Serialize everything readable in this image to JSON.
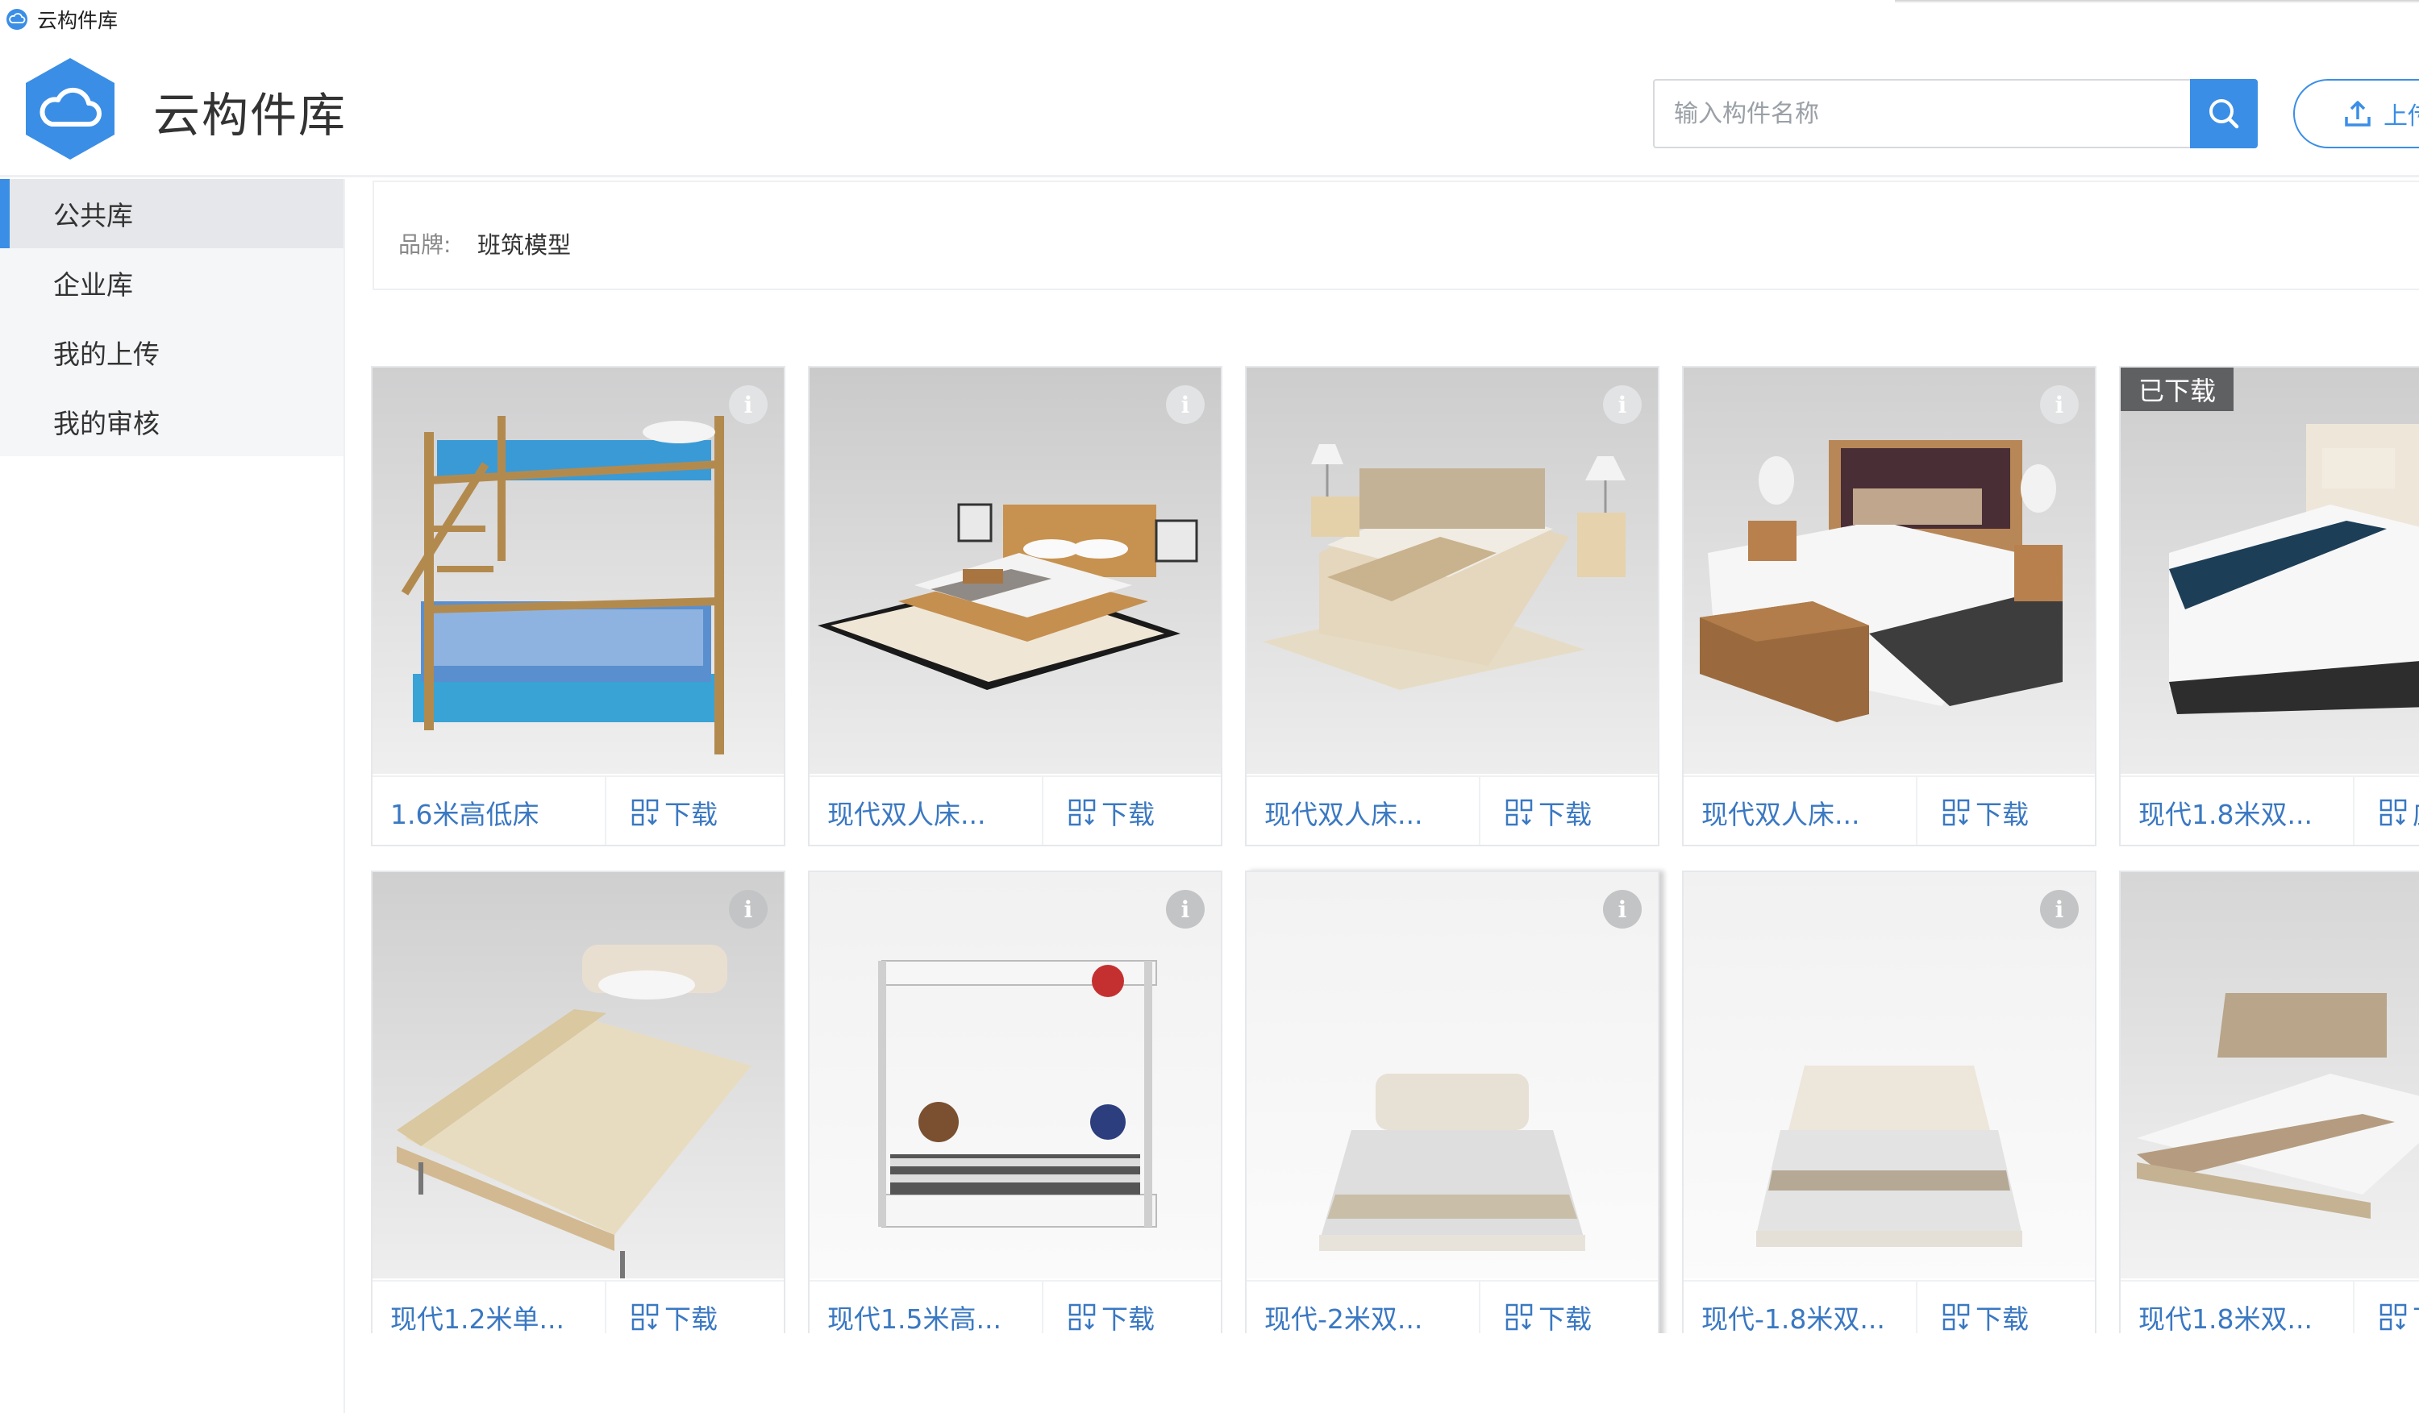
{
  "window": {
    "title": "云构件库"
  },
  "header": {
    "app_title": "云构件库",
    "search_placeholder": "输入构件名称",
    "upload_label": "上传"
  },
  "sidebar": {
    "items": [
      {
        "label": "公共库",
        "active": true
      },
      {
        "label": "企业库",
        "active": false
      },
      {
        "label": "我的上传",
        "active": false
      },
      {
        "label": "我的审核",
        "active": false
      }
    ]
  },
  "filter": {
    "brand_label": "品牌:",
    "brand_value": "班筑模型"
  },
  "cards": [
    {
      "name": "1.6米高低床",
      "download": "下载",
      "info": "i",
      "badge": ""
    },
    {
      "name": "现代双人床...",
      "download": "下载",
      "info": "i",
      "badge": ""
    },
    {
      "name": "现代双人床...",
      "download": "下载",
      "info": "i",
      "badge": ""
    },
    {
      "name": "现代双人床...",
      "download": "下载",
      "info": "i",
      "badge": ""
    },
    {
      "name": "现代1.8米双...",
      "download": "应",
      "info": "",
      "badge": "已下载"
    },
    {
      "name": "现代1.2米单...",
      "download": "下载",
      "info": "i",
      "badge": ""
    },
    {
      "name": "现代1.5米高...",
      "download": "下载",
      "info": "i",
      "badge": ""
    },
    {
      "name": "现代-2米双...",
      "download": "下载",
      "info": "i",
      "badge": ""
    },
    {
      "name": "现代-1.8米双...",
      "download": "下载",
      "info": "i",
      "badge": ""
    },
    {
      "name": "现代1.8米双...",
      "download": "下",
      "info": "",
      "badge": ""
    }
  ],
  "colors": {
    "accent": "#3a8ee6",
    "link": "#3a78c2",
    "badge_bg": "#5f6062"
  }
}
